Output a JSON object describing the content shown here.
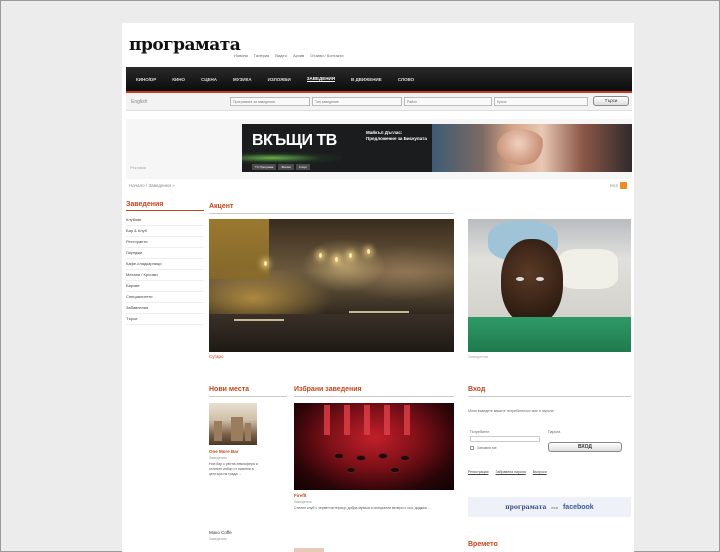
{
  "site": {
    "logo": "програмата"
  },
  "top_links": [
    "Новини",
    "Галерия",
    "Видео",
    "Архив",
    "Отзиви / Контакти"
  ],
  "nav": {
    "items": [
      "КИНО/DP",
      "КИНО",
      "СЦЕНА",
      "МУЗИКА",
      "ИЗЛОЖБИ",
      "ЗАВЕДЕНИЯ",
      "В ДВИЖЕНИЕ",
      "СЛОВО"
    ],
    "active_index": 5
  },
  "search": {
    "language": "English",
    "selects": [
      "Програмата за заведения",
      "Тип заведение",
      "Район",
      "Кухня"
    ],
    "button": "Търси"
  },
  "ad": {
    "label": "Реклама",
    "banner_title": "ВКЪЩИ ТВ",
    "banner_text": "Майкъл Дъглас: Предложение за Бискупата",
    "buttons": [
      "TV Програма",
      "Филми",
      "Спорт"
    ]
  },
  "breadcrumb": "Начало / Заведения »",
  "rss": "RSS",
  "sidebar": {
    "title": "Заведения",
    "items": [
      "Клубове",
      "Бар & Клуб",
      "Ресторанти",
      "Лаунджи",
      "Кафе-сладкарници",
      "Механи / Кръчми",
      "Барове",
      "Специалитети",
      "Забавления",
      "Търси"
    ]
  },
  "accent": {
    "title": "Акцент",
    "caption": "Сугаро",
    "photo_caption": "Заведения"
  },
  "new_places": {
    "title": "Нови места",
    "first": {
      "name": "One More Bar",
      "meta": "Заведения",
      "text": "Нов бар с уютна атмосфера и отличен избор от напитки в центъра на града ..."
    },
    "second": {
      "name": "Моко Coffe",
      "meta": "Заведения"
    }
  },
  "favorites": {
    "title": "Избрани заведения",
    "name": "Fireflt",
    "meta": "Заведения",
    "text": "Стилен клуб с червен интериор, добра музика и специални вечери с гост диджеи ..."
  },
  "login": {
    "title": "Вход",
    "intro": "Моля въведете вашите потребителско име и парола.",
    "username_label": "Потребител",
    "password_label": "Парола",
    "remember": "Запомни ме",
    "button": "ВХОД",
    "links": [
      "Регистрация",
      "Забравена парола",
      "Въпроси"
    ]
  },
  "facebook": {
    "a": "програмата",
    "b": "във",
    "c": "facebook"
  },
  "weather": {
    "title": "Времето"
  },
  "colors": {
    "accent": "#c2451c",
    "nav_bg": "#111111"
  }
}
